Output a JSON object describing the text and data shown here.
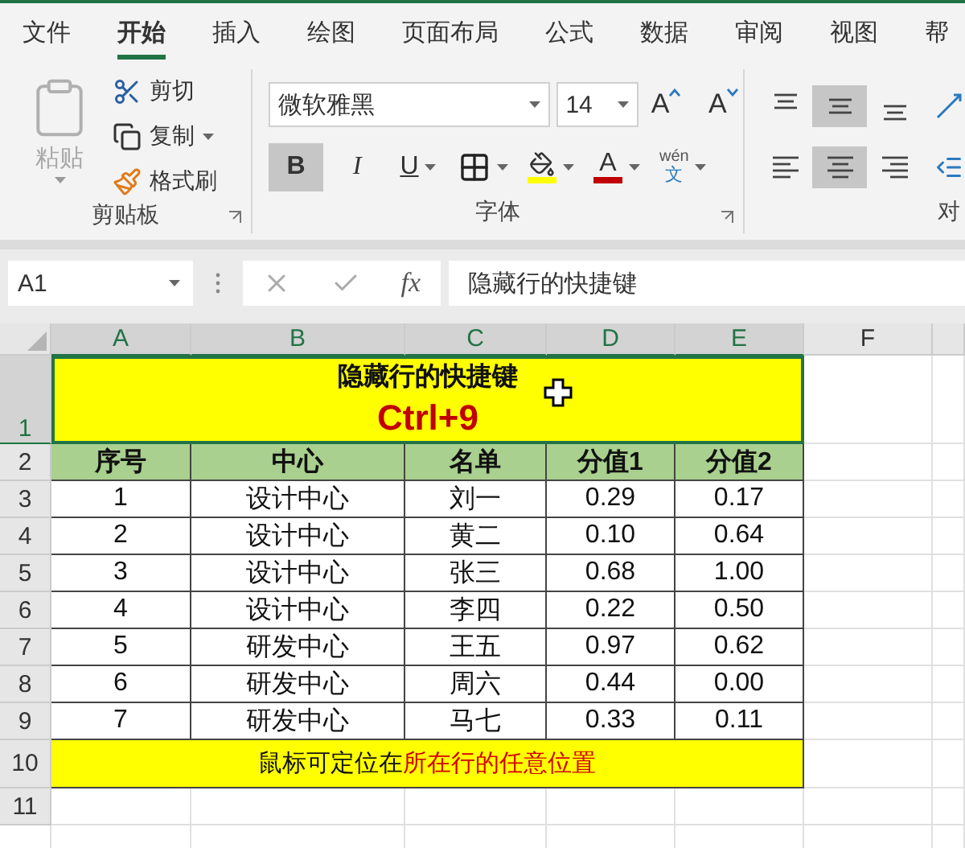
{
  "tabs": [
    {
      "label": "文件",
      "selected": false
    },
    {
      "label": "开始",
      "selected": true
    },
    {
      "label": "插入",
      "selected": false
    },
    {
      "label": "绘图",
      "selected": false
    },
    {
      "label": "页面布局",
      "selected": false
    },
    {
      "label": "公式",
      "selected": false
    },
    {
      "label": "数据",
      "selected": false
    },
    {
      "label": "审阅",
      "selected": false
    },
    {
      "label": "视图",
      "selected": false
    },
    {
      "label": "帮",
      "selected": false
    }
  ],
  "ribbon": {
    "groups": [
      {
        "kind": "clipboard",
        "label": "剪贴板",
        "paste": {
          "label": "粘贴",
          "disabled": true
        },
        "commands": [
          {
            "label": "剪切",
            "dropdown": false
          },
          {
            "label": "复制",
            "dropdown": true
          },
          {
            "label": "格式刷",
            "dropdown": false
          }
        ]
      },
      {
        "kind": "font",
        "label": "字体",
        "font": "微软雅黑",
        "size": "14",
        "grow": "A",
        "shrink": "A",
        "buttons": [
          {
            "kind": "bold",
            "label": "B",
            "selected": true,
            "dropdown": false
          },
          {
            "kind": "italic",
            "label": "I",
            "selected": false,
            "dropdown": false
          },
          {
            "kind": "underline",
            "label": "U",
            "selected": false,
            "dropdown": true
          },
          {
            "kind": "borders",
            "selected": false,
            "dropdown": true
          },
          {
            "kind": "fill",
            "color": "#ffff00",
            "selected": false,
            "dropdown": true
          },
          {
            "kind": "fontcolor",
            "label": "A",
            "color": "#c00000",
            "selected": false,
            "dropdown": true
          },
          {
            "kind": "phonetic",
            "label": "wén",
            "sub": "文",
            "selected": false,
            "dropdown": true
          }
        ]
      },
      {
        "kind": "alignment",
        "label": "对",
        "rows": [
          [
            {
              "kind": "top",
              "selected": false
            },
            {
              "kind": "middle",
              "selected": true
            },
            {
              "kind": "bottom",
              "selected": false
            },
            {
              "kind": "orientation",
              "selected": false
            }
          ],
          [
            {
              "kind": "left",
              "selected": false
            },
            {
              "kind": "center",
              "selected": true
            },
            {
              "kind": "right",
              "selected": false
            },
            {
              "kind": "indent",
              "selected": false
            }
          ]
        ]
      }
    ]
  },
  "formula_bar": {
    "name_box": "A1",
    "fx": "fx",
    "value": "隐藏行的快捷键"
  },
  "sheet": {
    "columns": [
      {
        "label": "A",
        "selected": true
      },
      {
        "label": "B",
        "selected": true
      },
      {
        "label": "C",
        "selected": true
      },
      {
        "label": "D",
        "selected": true
      },
      {
        "label": "E",
        "selected": true
      },
      {
        "label": "F",
        "selected": false
      }
    ],
    "rows": [
      {
        "number": "1",
        "selected": true,
        "kind": "title",
        "title": "隐藏行的快捷键",
        "subtitle": "Ctrl+9"
      },
      {
        "number": "2",
        "selected": false,
        "kind": "header",
        "cells": [
          "序号",
          "中心",
          "名单",
          "分值1",
          "分值2"
        ]
      },
      {
        "number": "3",
        "selected": false,
        "kind": "data",
        "cells": [
          "1",
          "设计中心",
          "刘一",
          "0.29",
          "0.17"
        ]
      },
      {
        "number": "4",
        "selected": false,
        "kind": "data",
        "cells": [
          "2",
          "设计中心",
          "黄二",
          "0.10",
          "0.64"
        ]
      },
      {
        "number": "5",
        "selected": false,
        "kind": "data",
        "cells": [
          "3",
          "设计中心",
          "张三",
          "0.68",
          "1.00"
        ]
      },
      {
        "number": "6",
        "selected": false,
        "kind": "data",
        "cells": [
          "4",
          "设计中心",
          "李四",
          "0.22",
          "0.50"
        ]
      },
      {
        "number": "7",
        "selected": false,
        "kind": "data",
        "cells": [
          "5",
          "研发中心",
          "王五",
          "0.97",
          "0.62"
        ]
      },
      {
        "number": "8",
        "selected": false,
        "kind": "data",
        "cells": [
          "6",
          "研发中心",
          "周六",
          "0.44",
          "0.00"
        ]
      },
      {
        "number": "9",
        "selected": false,
        "kind": "data",
        "cells": [
          "7",
          "研发中心",
          "马七",
          "0.33",
          "0.11"
        ]
      },
      {
        "number": "10",
        "selected": false,
        "kind": "note",
        "parts": [
          {
            "text": "鼠标可定位在",
            "emphasis": false
          },
          {
            "text": "所在行的任意位置",
            "emphasis": true
          }
        ]
      },
      {
        "number": "11",
        "selected": false,
        "kind": "empty"
      }
    ]
  }
}
